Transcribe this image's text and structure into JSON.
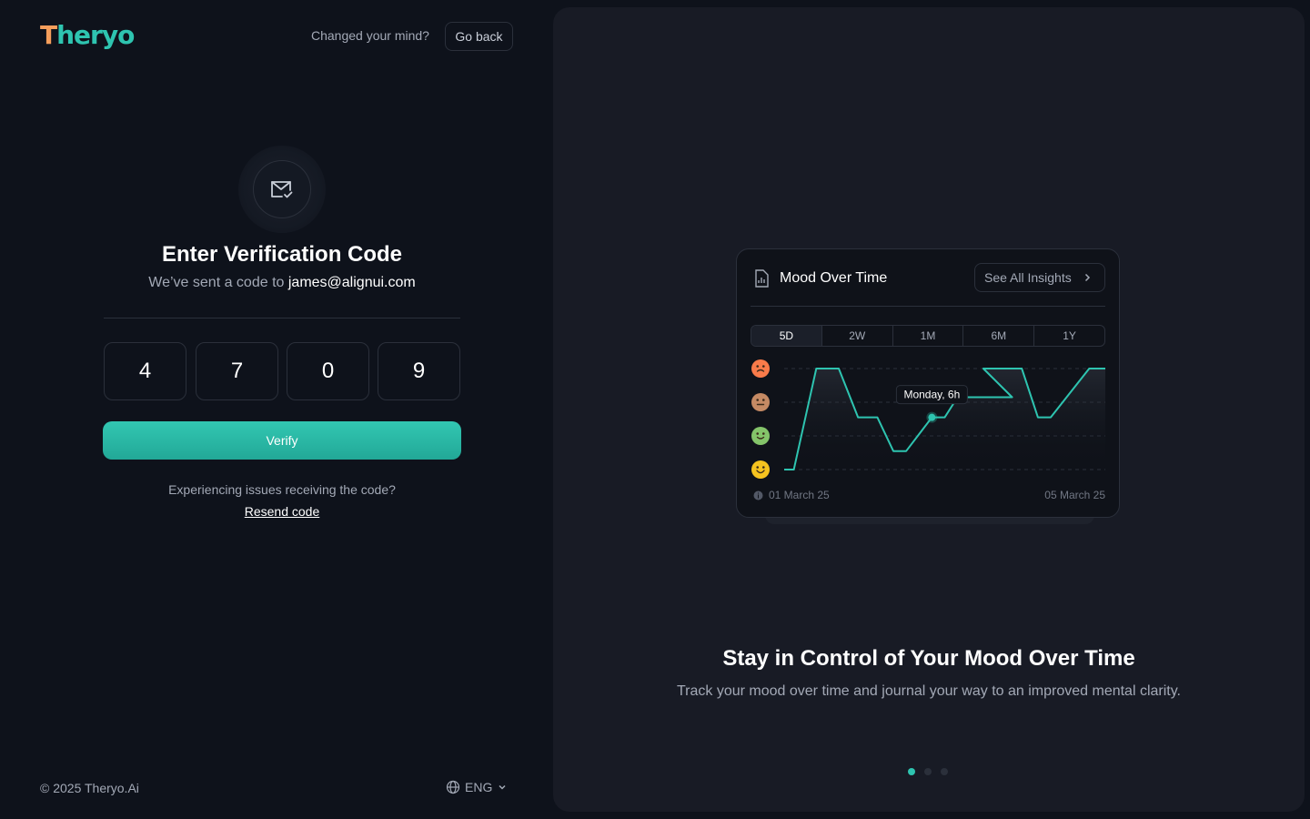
{
  "brand": {
    "logo_text": "Theryo",
    "accent": "#2ec4b0"
  },
  "header": {
    "changed_text": "Changed your mind?",
    "go_back_label": "Go back"
  },
  "verify": {
    "icon": "mail-check-icon",
    "title": "Enter Verification Code",
    "sent_prefix": "We’ve sent a code to",
    "email": "james@alignui.com",
    "digits": [
      "4",
      "7",
      "0",
      "9"
    ],
    "verify_label": "Verify",
    "issues_text": "Experiencing issues receiving the code?",
    "resend_label": "Resend code"
  },
  "footer": {
    "copyright": "© 2025 Theryo.Ai",
    "language": "ENG"
  },
  "promo": {
    "card": {
      "title": "Mood Over Time",
      "insights_label": "See All Insights",
      "tabs": [
        "5D",
        "2W",
        "1M",
        "6M",
        "1Y"
      ],
      "active_tab": "5D",
      "tooltip": "Monday, 6h",
      "start_date": "01 March 25",
      "end_date": "05 March 25"
    },
    "headline": "Stay in Control of Your Mood Over Time",
    "description": "Track your mood over time and journal your way to an improved mental clarity.",
    "carousel": {
      "count": 3,
      "active": 0
    }
  },
  "chart_data": {
    "type": "line",
    "title": "Mood Over Time",
    "y_levels": [
      "angry",
      "neutral",
      "calm",
      "happy"
    ],
    "series": [
      {
        "values": [
          [
            0.0,
            0.0
          ],
          [
            0.03,
            0.0
          ],
          [
            0.1,
            3.0
          ],
          [
            0.17,
            3.0
          ],
          [
            0.23,
            1.55
          ],
          [
            0.29,
            1.55
          ],
          [
            0.34,
            0.55
          ],
          [
            0.38,
            0.55
          ],
          [
            0.46,
            1.55
          ],
          [
            0.5,
            1.55
          ],
          [
            0.54,
            2.15
          ],
          [
            0.59,
            2.15
          ],
          [
            0.71,
            2.15
          ],
          [
            0.62,
            3.0
          ],
          [
            0.74,
            3.0
          ],
          [
            0.79,
            1.55
          ],
          [
            0.83,
            1.55
          ],
          [
            0.95,
            3.0
          ],
          [
            1.0,
            3.0
          ]
        ]
      }
    ],
    "highlight": {
      "x": 0.46,
      "y": 1.55,
      "label": "Monday, 6h"
    },
    "line_color": "#2ec4b0",
    "emoji_colors": [
      "#f97b4a",
      "#c58a64",
      "#84c46a",
      "#f6c31f"
    ]
  }
}
